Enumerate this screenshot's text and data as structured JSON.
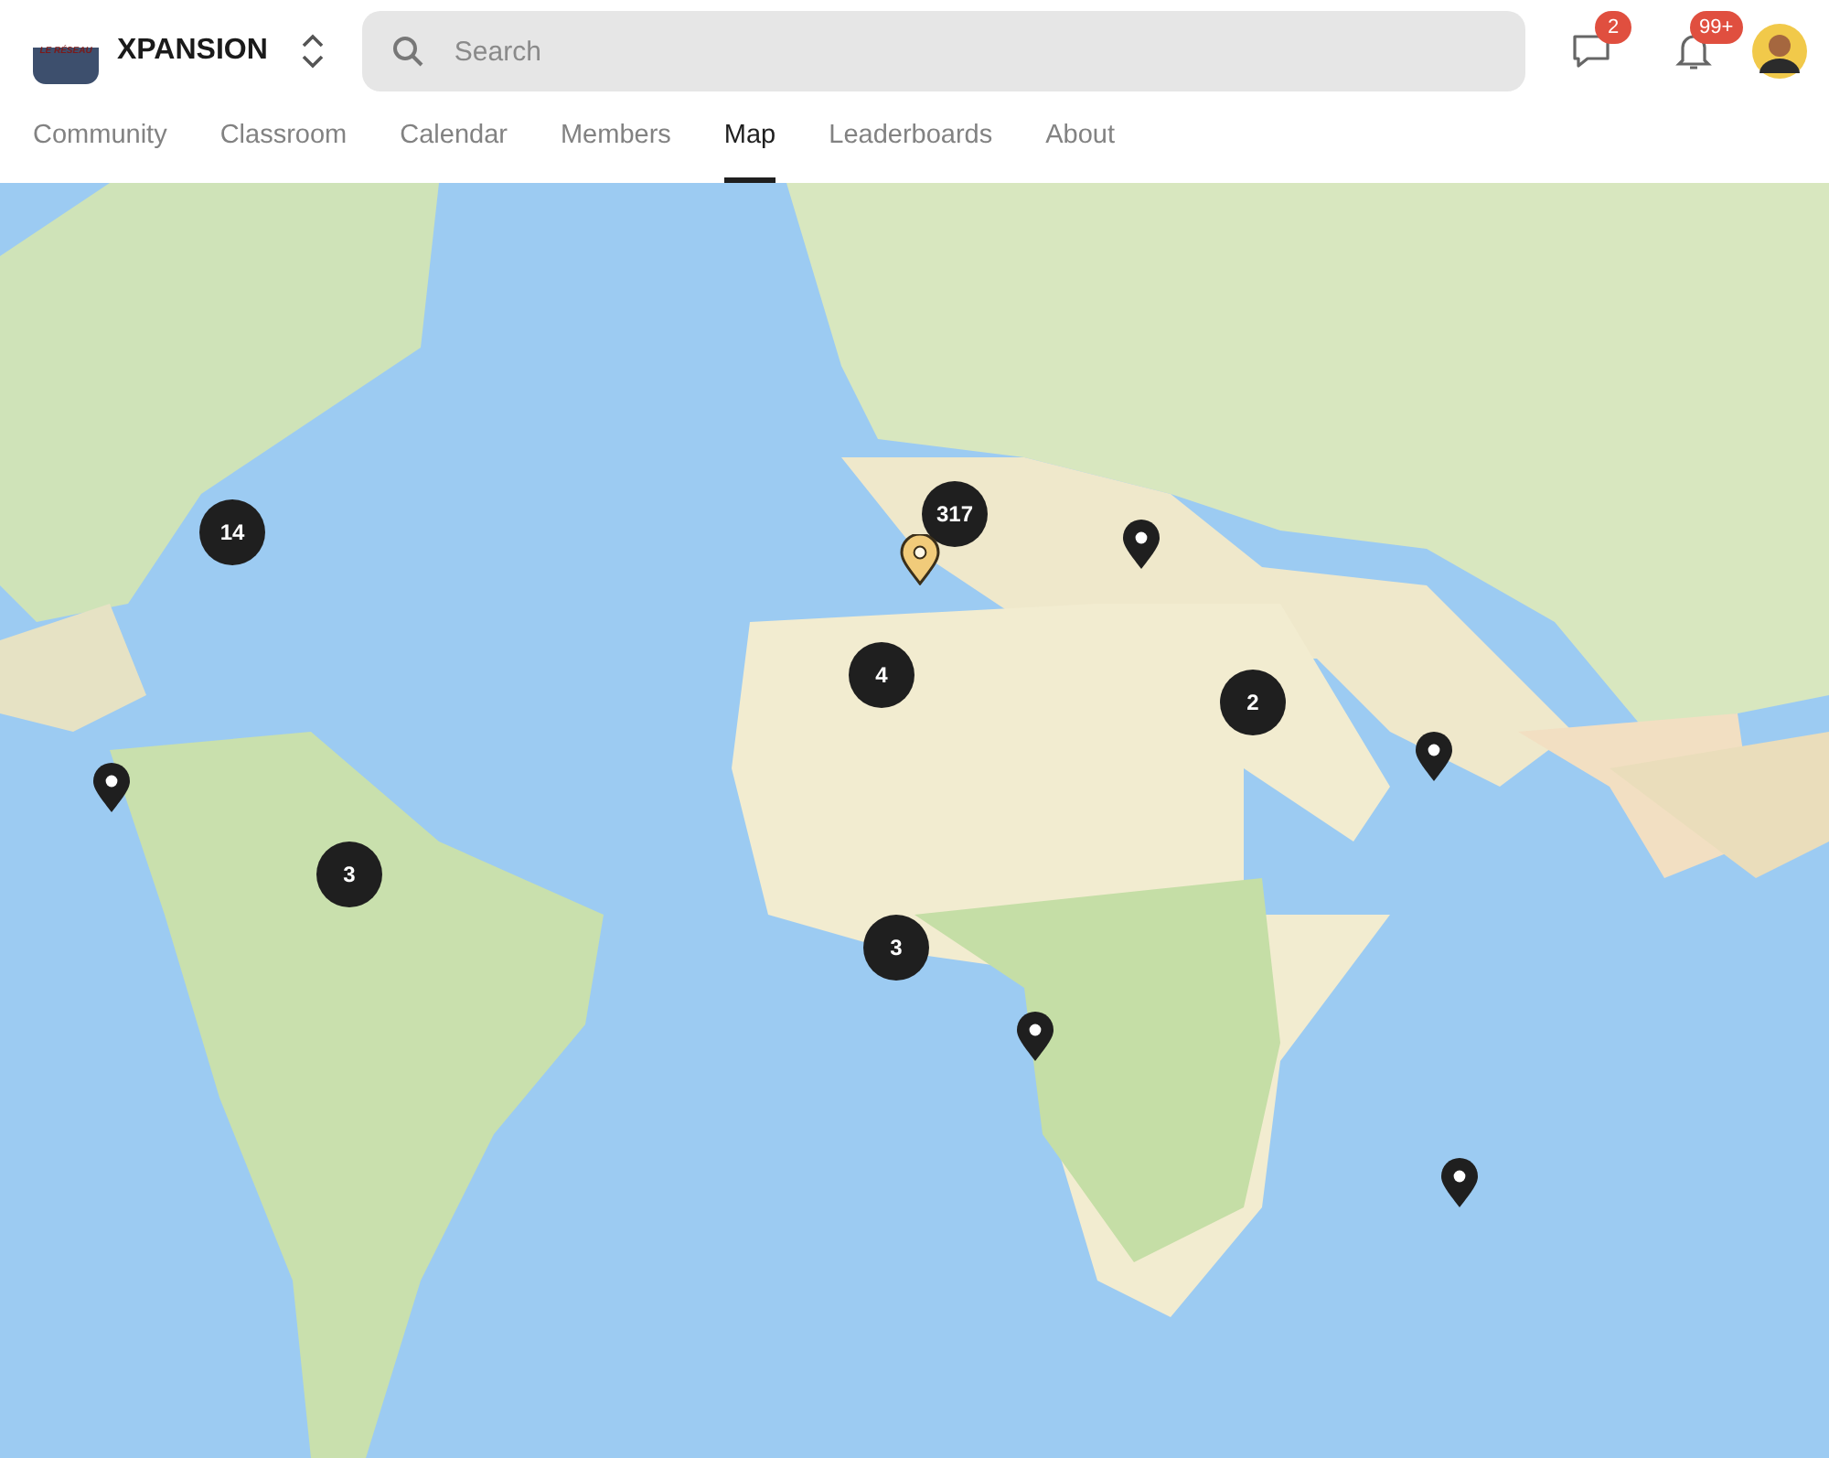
{
  "header": {
    "logo_text": "LE RÉSEAU",
    "group_name": "XPANSION",
    "search": {
      "placeholder": "Search"
    },
    "chat_badge": "2",
    "notification_badge": "99+"
  },
  "tabs": [
    {
      "label": "Community",
      "selected": false
    },
    {
      "label": "Classroom",
      "selected": false
    },
    {
      "label": "Calendar",
      "selected": false
    },
    {
      "label": "Members",
      "selected": false
    },
    {
      "label": "Map",
      "selected": true
    },
    {
      "label": "Leaderboards",
      "selected": false
    },
    {
      "label": "About",
      "selected": false
    }
  ],
  "map": {
    "kind": "picture",
    "markers": [
      {
        "kind": "cluster",
        "count": "14"
      },
      {
        "kind": "cluster",
        "count": "317"
      },
      {
        "kind": "highlight"
      },
      {
        "kind": "pin"
      },
      {
        "kind": "cluster",
        "count": "4"
      },
      {
        "kind": "cluster",
        "count": "2"
      },
      {
        "kind": "pin"
      },
      {
        "kind": "pin"
      },
      {
        "kind": "cluster",
        "count": "3"
      },
      {
        "kind": "cluster",
        "count": "3"
      },
      {
        "kind": "pin"
      },
      {
        "kind": "pin"
      }
    ]
  }
}
